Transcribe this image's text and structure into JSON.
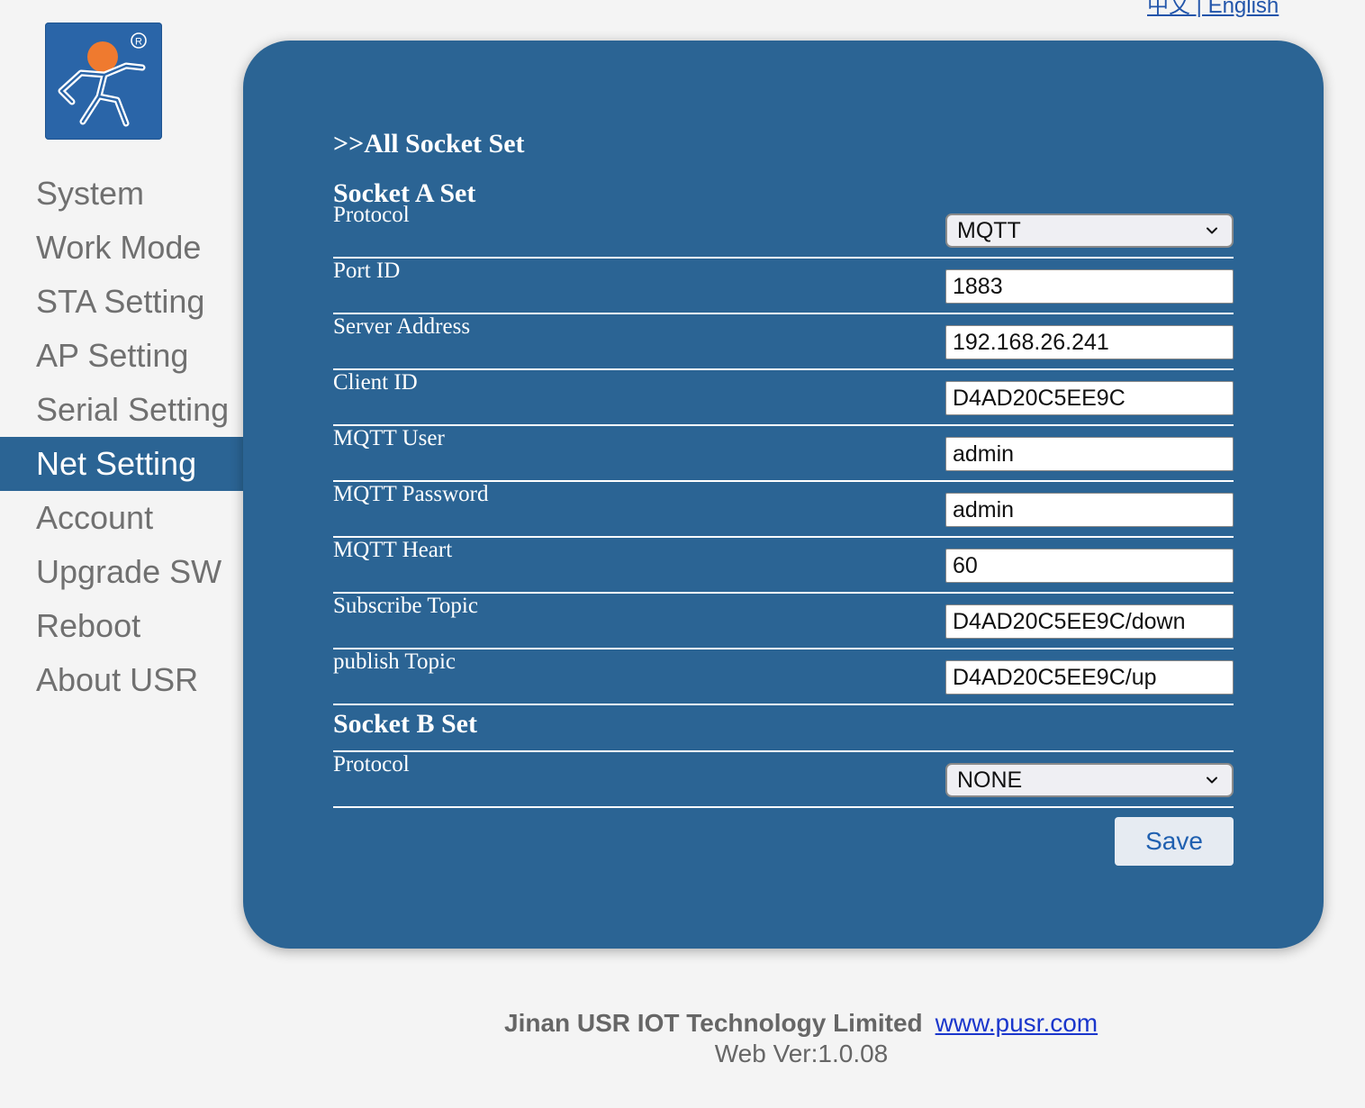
{
  "header": {
    "top_link_partial": "中文 | English"
  },
  "logo": {
    "icon": "usr-running-man-logo-icon",
    "registered_mark": "®"
  },
  "sidebar": {
    "items": [
      {
        "label": "System"
      },
      {
        "label": "Work Mode"
      },
      {
        "label": "STA Setting"
      },
      {
        "label": "AP Setting"
      },
      {
        "label": "Serial Setting"
      },
      {
        "label": "Net Setting",
        "active": true
      },
      {
        "label": "Account"
      },
      {
        "label": "Upgrade SW"
      },
      {
        "label": "Reboot"
      },
      {
        "label": "About USR"
      }
    ]
  },
  "main": {
    "title": ">>All Socket Set",
    "socket_a": {
      "title": "Socket A Set",
      "protocol": {
        "label": "Protocol",
        "value": "MQTT"
      },
      "fields": [
        {
          "label": "Port ID",
          "value": "1883"
        },
        {
          "label": "Server Address",
          "value": "192.168.26.241"
        },
        {
          "label": "Client ID",
          "value": "D4AD20C5EE9C"
        },
        {
          "label": "MQTT User",
          "value": "admin"
        },
        {
          "label": "MQTT Password",
          "value": "admin"
        },
        {
          "label": "MQTT Heart",
          "value": "60"
        },
        {
          "label": "Subscribe Topic",
          "value": "D4AD20C5EE9C/down"
        },
        {
          "label": "publish Topic",
          "value": "D4AD20C5EE9C/up"
        }
      ]
    },
    "socket_b": {
      "title": "Socket B Set",
      "protocol": {
        "label": "Protocol",
        "value": "NONE"
      }
    },
    "save_label": "Save"
  },
  "footer": {
    "company": "Jinan USR IOT Technology Limited",
    "link": "www.pusr.com",
    "version": "Web Ver:1.0.08"
  },
  "colors": {
    "panel": "#2b6494",
    "active_nav": "#2b6494",
    "background": "#f4f4f4",
    "logo_orange": "#ef7a2f"
  }
}
